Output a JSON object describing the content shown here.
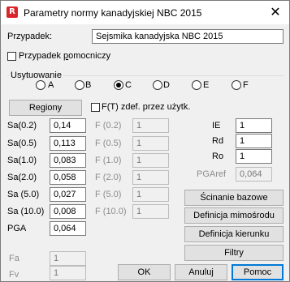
{
  "window": {
    "title": "Parametry normy kanadyjskiej NBC 2015",
    "close_glyph": "✕"
  },
  "case": {
    "label": "Przypadek:",
    "value": "Sejsmika kanadyjska NBC 2015"
  },
  "aux_case": {
    "label_prefix": "Przypadek ",
    "label_underlined": "p",
    "label_rest": "omocniczy",
    "checked": false
  },
  "location": {
    "label": "Usytuowanie",
    "options": [
      {
        "label": "A",
        "selected": false
      },
      {
        "label": "B",
        "selected": false
      },
      {
        "label": "C",
        "selected": true
      },
      {
        "label": "D",
        "selected": false
      },
      {
        "label": "E",
        "selected": false
      },
      {
        "label": "F",
        "selected": false
      }
    ]
  },
  "regions_button": "Regiony",
  "user_defined": {
    "label": "F(T) zdef. przez użytk.",
    "checked": false
  },
  "sa": [
    {
      "label": "Sa(0.2)",
      "value": "0,14",
      "f_label": "F (0.2)",
      "f_value": "1"
    },
    {
      "label": "Sa(0.5)",
      "value": "0,113",
      "f_label": "F (0.5)",
      "f_value": "1"
    },
    {
      "label": "Sa(1.0)",
      "value": "0,083",
      "f_label": "F (1.0)",
      "f_value": "1"
    },
    {
      "label": "Sa(2.0)",
      "value": "0,058",
      "f_label": "F (2.0)",
      "f_value": "1"
    },
    {
      "label": "Sa (5.0)",
      "value": "0,027",
      "f_label": "F (5.0)",
      "f_value": "1"
    },
    {
      "label": "Sa (10.0)",
      "value": "0,008",
      "f_label": "F (10.0)",
      "f_value": "1"
    }
  ],
  "pga": {
    "label": "PGA",
    "value": "0,064"
  },
  "factors": {
    "ie": {
      "label": "IE",
      "value": "1"
    },
    "rd": {
      "label": "Rd",
      "value": "1"
    },
    "ro": {
      "label": "Ro",
      "value": "1"
    },
    "pgaref": {
      "label": "PGAref",
      "value": "0,064"
    }
  },
  "fa": {
    "label": "Fa",
    "value": "1"
  },
  "fv": {
    "label": "Fv",
    "value": "1"
  },
  "side_buttons": {
    "base_shear": "Ścinanie bazowe",
    "eccentricity": "Definicja mimośrodu",
    "direction": "Definicja kierunku",
    "filters": "Filtry"
  },
  "footer": {
    "ok": "OK",
    "cancel": "Anuluj",
    "help": "Pomoc"
  }
}
